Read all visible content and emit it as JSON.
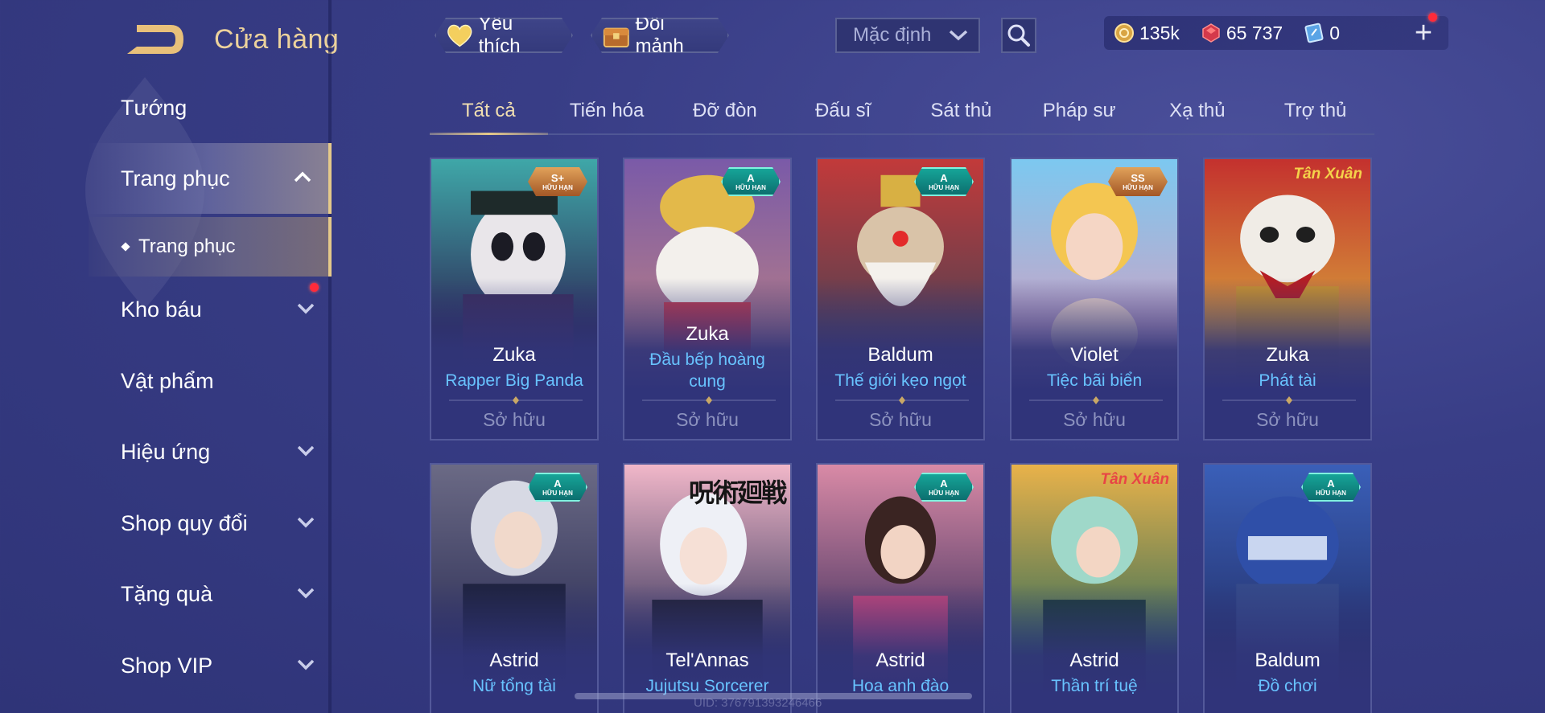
{
  "header": {
    "title": "Cửa hàng",
    "favorite_label": "Yêu thích",
    "fragment_label": "Đổi mảnh",
    "sort_value": "Mặc định"
  },
  "currency": {
    "gold": "135k",
    "diamond": "65 737",
    "voucher": "0",
    "add_label": "+"
  },
  "sidebar": {
    "items": [
      {
        "label": "Tướng"
      },
      {
        "label": "Trang phục"
      },
      {
        "label": "Kho báu"
      },
      {
        "label": "Vật phẩm"
      },
      {
        "label": "Hiệu ứng"
      },
      {
        "label": "Shop quy đổi"
      },
      {
        "label": "Tặng quà"
      },
      {
        "label": "Shop VIP"
      }
    ],
    "sub_item": "Trang phục"
  },
  "tabs": [
    "Tất cả",
    "Tiến hóa",
    "Đỡ đòn",
    "Đấu sĩ",
    "Sát thủ",
    "Pháp sư",
    "Xạ thủ",
    "Trợ thủ"
  ],
  "cards": [
    {
      "hero": "Zuka",
      "skin": "Rapper Big Panda",
      "status": "Sở hữu",
      "badge_rank": "S+",
      "badge_text": "HỮU HẠN"
    },
    {
      "hero": "Zuka",
      "skin": "Đầu bếp hoàng cung",
      "status": "Sở hữu",
      "badge_rank": "A",
      "badge_text": "HỮU HẠN"
    },
    {
      "hero": "Baldum",
      "skin": "Thế giới kẹo ngọt",
      "status": "Sở hữu",
      "badge_rank": "A",
      "badge_text": "HỮU HẠN"
    },
    {
      "hero": "Violet",
      "skin": "Tiệc bãi biển",
      "status": "Sở hữu",
      "badge_rank": "SS",
      "badge_text": "HỮU HẠN"
    },
    {
      "hero": "Zuka",
      "skin": "Phát tài",
      "status": "Sở hữu",
      "event_tag": "Tân Xuân"
    },
    {
      "hero": "Astrid",
      "skin": "Nữ tổng tài",
      "badge_rank": "A",
      "badge_text": "HỮU HẠN"
    },
    {
      "hero": "Tel'Annas",
      "skin": "Jujutsu Sorcerer",
      "event_tag": "呪術廻戦"
    },
    {
      "hero": "Astrid",
      "skin": "Hoa anh đào",
      "badge_rank": "A",
      "badge_text": "HỮU HẠN"
    },
    {
      "hero": "Astrid",
      "skin": "Thần trí tuệ",
      "event_tag": "Tân Xuân"
    },
    {
      "hero": "Baldum",
      "skin": "Đồ chơi",
      "badge_rank": "A",
      "badge_text": "HỮU HẠN"
    }
  ],
  "footer": {
    "uid": "UID: 376791393246466"
  }
}
